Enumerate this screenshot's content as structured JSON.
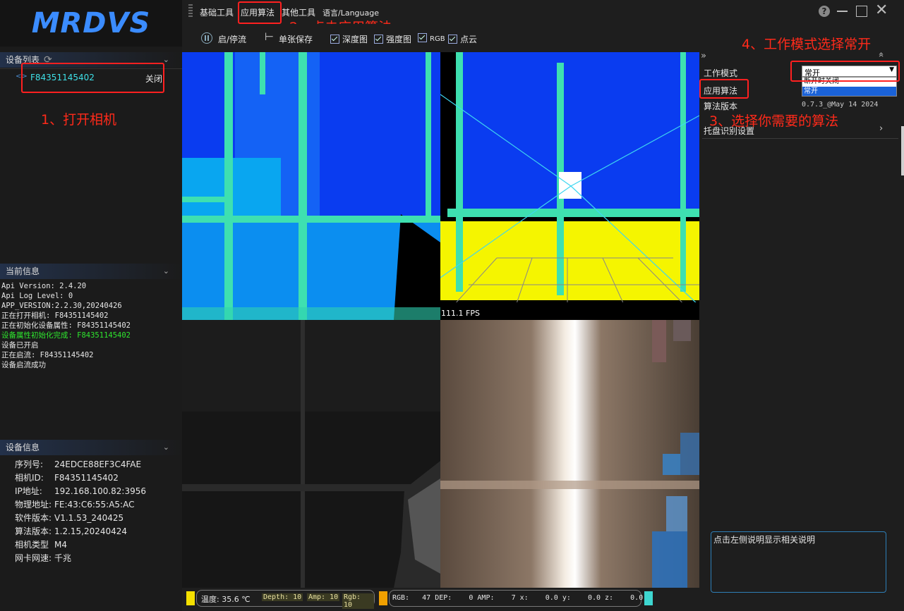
{
  "logo": {
    "text": "MRDVS"
  },
  "device_list": {
    "header": "设备列表",
    "device_id": "F84351145402",
    "device_action": "关闭"
  },
  "current_info": {
    "header": "当前信息",
    "lines": [
      {
        "text": "Api Version: 2.4.20",
        "color": "#e6e6e6"
      },
      {
        "text": "Api Log Level: 0",
        "color": "#e6e6e6"
      },
      {
        "text": "APP_VERSION:2.2.30,20240426",
        "color": "#e6e6e6"
      },
      {
        "text": "正在打开相机: F84351145402",
        "color": "#e6e6e6"
      },
      {
        "text": "正在初始化设备属性: F84351145402",
        "color": "#e6e6e6"
      },
      {
        "text": "设备属性初始化完成: F84351145402",
        "color": "#2ee62e"
      },
      {
        "text": "设备已开启",
        "color": "#e6e6e6"
      },
      {
        "text": "正在启流: F84351145402",
        "color": "#e6e6e6"
      },
      {
        "text": "设备启流成功",
        "color": "#e6e6e6"
      }
    ]
  },
  "device_info": {
    "header": "设备信息",
    "rows": [
      {
        "k": "序列号:",
        "v": "24EDCE88EF3C4FAE"
      },
      {
        "k": "相机ID:",
        "v": "F84351145402"
      },
      {
        "k": "IP地址:",
        "v": "192.168.100.82:3956"
      },
      {
        "k": "物理地址:",
        "v": "FE:43:C6:55:A5:AC"
      },
      {
        "k": "软件版本:",
        "v": "V1.1.53_240425"
      },
      {
        "k": "算法版本:",
        "v": "1.2.15,20240424"
      },
      {
        "k": "相机类型",
        "v": "M4"
      },
      {
        "k": "网卡网速:",
        "v": "千兆"
      }
    ]
  },
  "menu": {
    "basic": "基础工具",
    "algo": "应用算法",
    "other": "其他工具",
    "language": "语言/Language"
  },
  "toolbar": {
    "startstop": "启/停流",
    "save": "单张保存",
    "depth": "深度图",
    "intensity": "强度图",
    "rgb": "RGB",
    "pointcloud": "点云"
  },
  "annotations": {
    "step1": "1、打开相机",
    "step2": "2、点击应用算法",
    "step3": "3、选择你需要的算法",
    "step4": "4、工作模式选择常开"
  },
  "viewer": {
    "fps": "111.1 FPS"
  },
  "right_panel": {
    "work_mode_label": "工作模式",
    "work_mode_value": "常开",
    "work_mode_options": [
      "断开时关闭",
      "常开"
    ],
    "algo_label": "应用算法",
    "algo_version_label": "算法版本",
    "algo_version_value": "0.7.3_@May 14 2024",
    "tray_label": "托盘识别设置",
    "description": "点击左侧说明显示相关说明"
  },
  "status": {
    "temp": "温度: 35.6 ℃",
    "depth": "Depth: 10",
    "amp": "Amp: 10",
    "rgb": "Rgb: 10",
    "readout": "RGB:   47 DEP:    0 AMP:    7 x:    0.0 y:    0.0 z:    0.0"
  },
  "colors": {
    "accent": "#3b8cff",
    "depth_blue": "#0a3cf0",
    "depth_cyan": "#3ee0b0",
    "depth_yellow": "#f5f500",
    "annotation_red": "#ff2a1a",
    "status_yellow": "#f5e000",
    "status_orange": "#f0a000",
    "status_teal": "#3ed6d0"
  }
}
